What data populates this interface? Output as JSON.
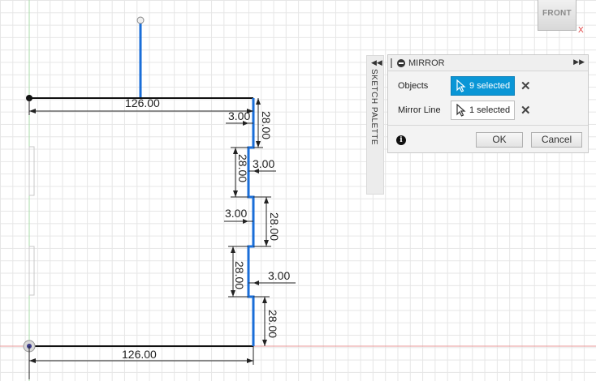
{
  "viewcube": {
    "face_label": "FRONT",
    "axis_label": "X"
  },
  "palette": {
    "label": "SKETCH PALETTE",
    "collapse_icon": "double-chevron-left-icon"
  },
  "dialog": {
    "title": "MIRROR",
    "header_icon": "minus-circle-icon",
    "expand_icon": "double-chevron-right-icon",
    "rows": [
      {
        "label": "Objects",
        "value": "9 selected",
        "state": "active"
      },
      {
        "label": "Mirror Line",
        "value": "1 selected",
        "state": "inactive"
      }
    ],
    "ok_label": "OK",
    "cancel_label": "Cancel",
    "info_glyph": "i"
  },
  "dimensions": {
    "top_width": "126.00",
    "bottom_width": "126.00",
    "step_1": "3.00",
    "step_2": "3.00",
    "step_3": "3.00",
    "step_4": "3.00",
    "height_1": "28.00",
    "height_2": "28.00",
    "height_3": "28.00",
    "height_4": "28.00",
    "height_5": "28.00"
  },
  "colors": {
    "selected_line": "#1a6ed8",
    "sketch_line": "#111111",
    "active_button": "#0a96d6",
    "x_axis": "#e04040",
    "y_axis": "#7fc97f"
  }
}
